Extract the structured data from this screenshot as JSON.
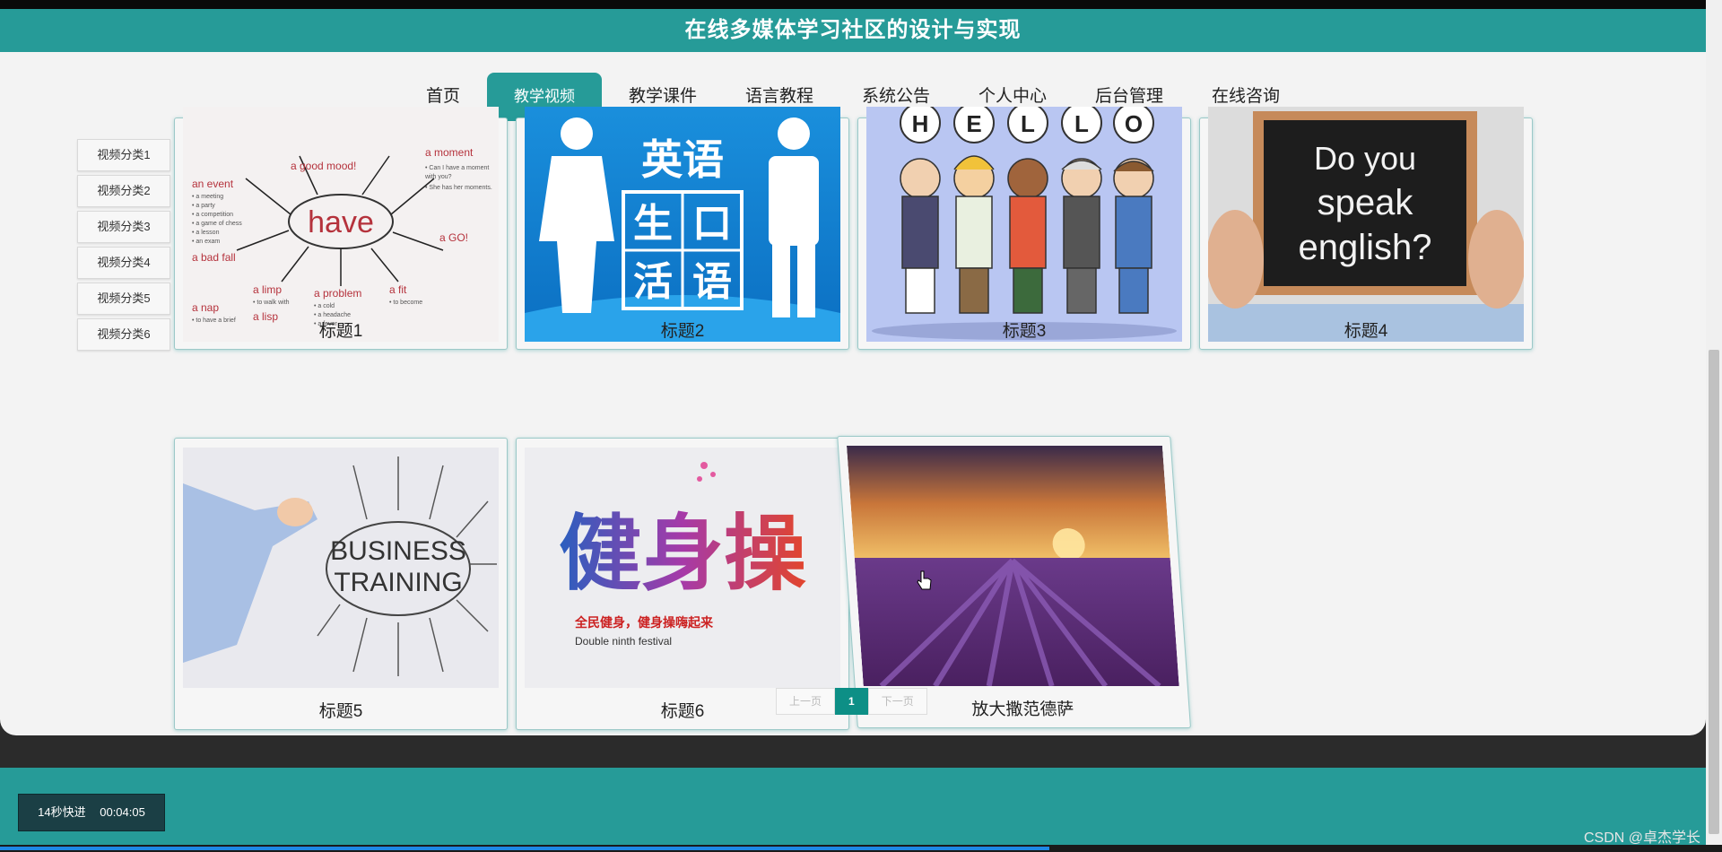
{
  "header": {
    "title": "在线多媒体学习社区的设计与实现"
  },
  "nav": {
    "items": [
      {
        "label": "首页"
      },
      {
        "label": "教学视频"
      },
      {
        "label": "教学课件"
      },
      {
        "label": "语言教程"
      },
      {
        "label": "系统公告"
      },
      {
        "label": "个人中心"
      },
      {
        "label": "后台管理"
      },
      {
        "label": "在线咨询"
      }
    ],
    "active": "教学视频"
  },
  "sidebar": {
    "items": [
      "视频分类1",
      "视频分类2",
      "视频分类3",
      "视频分类4",
      "视频分类5",
      "视频分类6"
    ]
  },
  "cards": [
    {
      "caption": "标题1",
      "image": "have-english-vocabulary"
    },
    {
      "caption": "标题2",
      "image": "英语生活口语"
    },
    {
      "caption": "标题3",
      "image": "hello-cartoon-kids"
    },
    {
      "caption": "标题4",
      "image": "Do you speak english?"
    },
    {
      "caption": "标题5",
      "image": "BUSINESS TRAINING"
    },
    {
      "caption": "标题6",
      "image": "健身操"
    },
    {
      "caption": "放大撒范德萨",
      "image": "lavender-field-sunset"
    }
  ],
  "images": {
    "card1": {
      "center_word": "have",
      "words": [
        "an event",
        "a good mood!",
        "a moment",
        "a bad fall",
        "a limp",
        "a lisp",
        "a problem",
        "a fit",
        "a nap",
        "a GO!"
      ]
    },
    "card2": {
      "line1": "英语",
      "line2a": "生",
      "line2b": "口",
      "line3a": "活",
      "line3b": "语"
    },
    "card3": {
      "letters": [
        "H",
        "E",
        "L",
        "L",
        "O"
      ]
    },
    "card4": {
      "line1": "Do you",
      "line2": "speak",
      "line3": "english?"
    },
    "card5": {
      "line1": "BUSINESS",
      "line2": "TRAINING"
    },
    "card6": {
      "title": "健身操",
      "slogan": "全民健身，健身操嗨起来",
      "sub": "Double ninth festival"
    }
  },
  "pager": {
    "prev": "上一页",
    "current": "1",
    "next": "下一页"
  },
  "player": {
    "speed_label": "14秒快进",
    "time": "00:04:05"
  },
  "watermark": "CSDN @卓杰学长",
  "colors": {
    "accent": "#269b98",
    "pager_active": "#0d8f86",
    "badge": "#1b3f45"
  }
}
